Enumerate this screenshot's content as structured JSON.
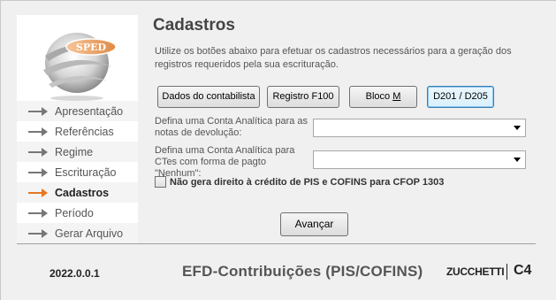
{
  "sidebar": {
    "logo_text": "SPED",
    "items": [
      {
        "label": "Apresentação",
        "arrow_color": "#777777"
      },
      {
        "label": "Referências",
        "arrow_color": "#777777"
      },
      {
        "label": "Regime",
        "arrow_color": "#777777"
      },
      {
        "label": "Escrituração",
        "arrow_color": "#777777"
      },
      {
        "label": "Cadastros",
        "arrow_color": "#e87722",
        "selected": true
      },
      {
        "label": "Período",
        "arrow_color": "#777777"
      },
      {
        "label": "Gerar Arquivo",
        "arrow_color": "#777777"
      }
    ]
  },
  "main": {
    "title": "Cadastros",
    "description": "Utilize os botões abaixo para efetuar os cadastros necessários para a geração dos registros requeridos pela sua escrituração.",
    "buttons": {
      "dados": "Dados do contabilista",
      "registro": "Registro F100",
      "bloco_prefix": "Bloco ",
      "bloco_key": "M",
      "d201": "D201 / D205"
    },
    "field1_label": "Defina uma Conta Analítica para as notas de devolução:",
    "field1_value": "",
    "field2_label": "Defina uma Conta Analítica para CTes com forma de pagto \"Nenhum\":",
    "field2_value": "",
    "checkbox_label": "Não gera direito à crédito de PIS e COFINS para CFOP 1303",
    "checkbox_checked": false,
    "next_button": "Avançar"
  },
  "footer": {
    "version": "2022.0.0.1",
    "product": "EFD-Contribuições (PIS/COFINS)",
    "brand": "ZUCCHETTI",
    "brand_suffix": "C4"
  },
  "colors": {
    "accent": "#e87722",
    "arrow": "#777777"
  }
}
